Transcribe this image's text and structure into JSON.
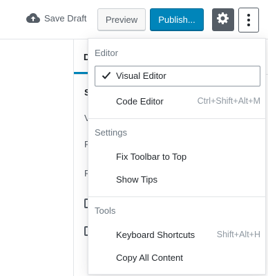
{
  "toolbar": {
    "save_draft_label": "Save Draft",
    "save_draft_icon": "cloud-upload-icon",
    "preview_label": "Preview",
    "publish_label": "Publish...",
    "settings_icon": "gear-icon",
    "more_icon": "vertical-ellipsis-icon"
  },
  "sidebar": {
    "tab_label": "D",
    "rows": [
      "S",
      "V",
      "P",
      "P"
    ]
  },
  "menu": {
    "groups": [
      {
        "title": "Editor",
        "items": [
          {
            "label": "Visual Editor",
            "shortcut": "",
            "checked": true
          },
          {
            "label": "Code Editor",
            "shortcut": "Ctrl+Shift+Alt+M",
            "checked": false
          }
        ]
      },
      {
        "title": "Settings",
        "items": [
          {
            "label": "Fix Toolbar to Top",
            "shortcut": ""
          },
          {
            "label": "Show Tips",
            "shortcut": ""
          }
        ]
      },
      {
        "title": "Tools",
        "items": [
          {
            "label": "Keyboard Shortcuts",
            "shortcut": "Shift+Alt+H"
          },
          {
            "label": "Copy All Content",
            "shortcut": ""
          }
        ]
      }
    ]
  },
  "colors": {
    "primary": "#0085ba",
    "dark_button": "#555d66",
    "muted_text": "#8f98a1"
  }
}
